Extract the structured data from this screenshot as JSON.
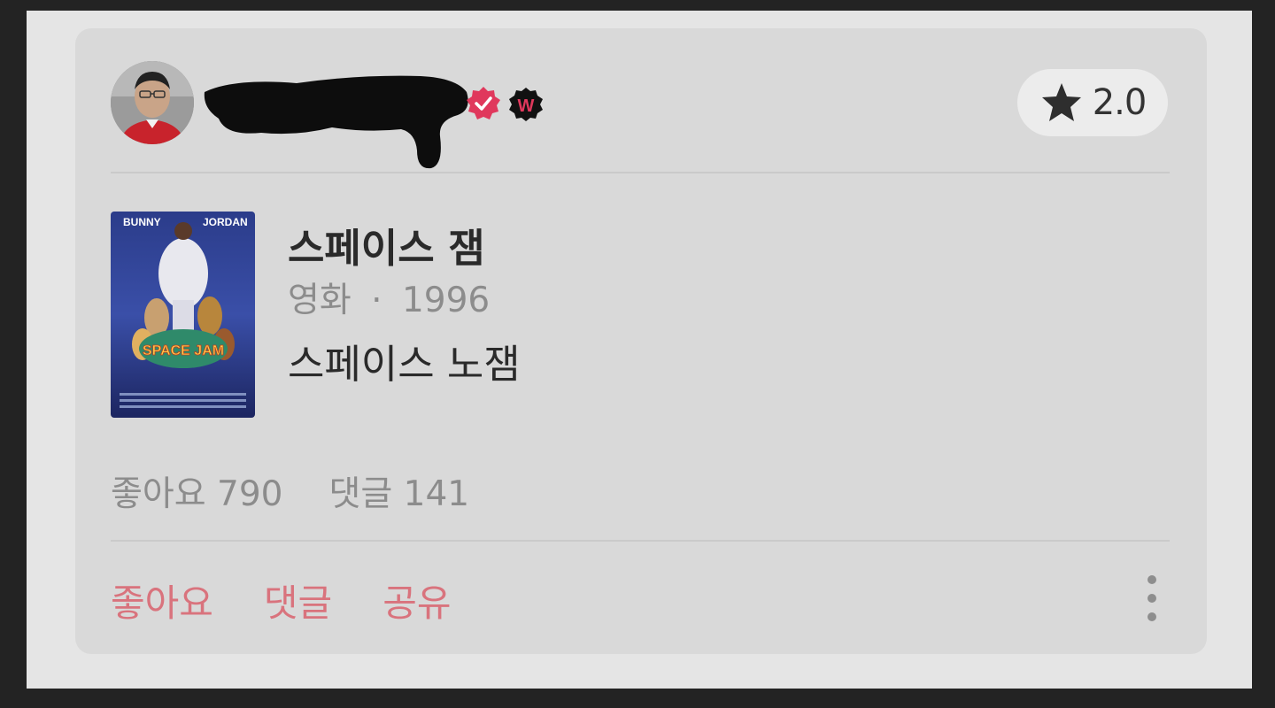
{
  "review": {
    "rating": "2.0",
    "movie": {
      "title": "스페이스 잼",
      "category": "영화",
      "separator": "·",
      "year": "1996"
    },
    "comment": "스페이스 노잼",
    "stats": {
      "likes": "좋아요 790",
      "comments": "댓글 141"
    },
    "actions": {
      "like": "좋아요",
      "comment": "댓글",
      "share": "공유"
    },
    "badges": {
      "verified_icon": "verified-check-icon",
      "watcha_icon": "w-badge-icon",
      "watcha_letter": "W",
      "rating_icon": "star-icon",
      "more_icon": "kebab-menu-icon"
    },
    "poster_text": {
      "left_name": "BUNNY",
      "right_name": "JORDAN",
      "logo": "SPACE JAM"
    },
    "colors": {
      "accent": "#d9737d",
      "badge_pink": "#e0385c"
    }
  }
}
